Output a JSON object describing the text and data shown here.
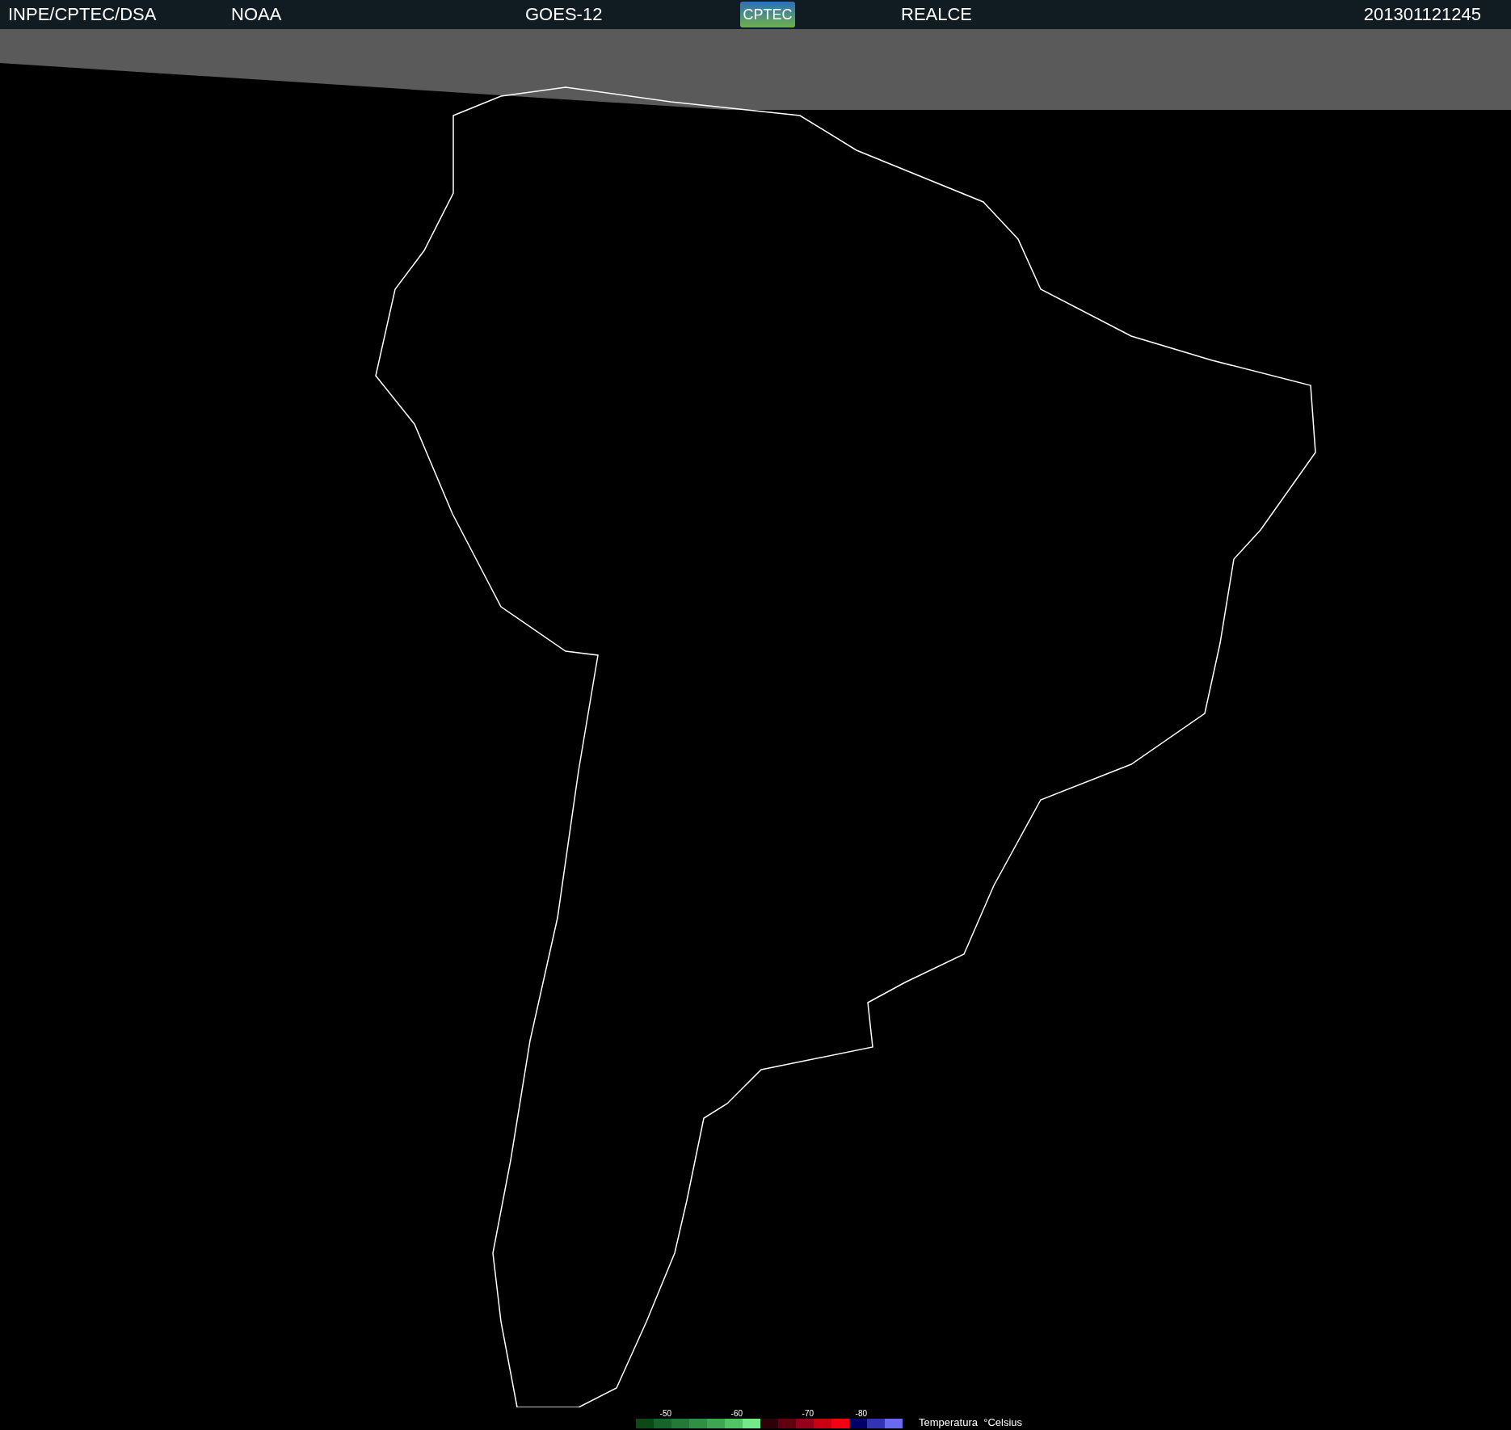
{
  "header": {
    "source": "INPE/CPTEC/DSA",
    "agency": "NOAA",
    "satellite": "GOES-12",
    "logo": "CPTEC",
    "product": "REALCE",
    "timestamp": "201301121245"
  },
  "legend": {
    "title": "Temperatura  °Celsius",
    "swatches": [
      {
        "color": "#0b4a16"
      },
      {
        "color": "#17652a",
        "label": "-50"
      },
      {
        "color": "#237a36"
      },
      {
        "color": "#2f9043"
      },
      {
        "color": "#3ea653"
      },
      {
        "color": "#52c466",
        "label": "-60"
      },
      {
        "color": "#74e88a"
      },
      {
        "color": "#2e0008"
      },
      {
        "color": "#600010"
      },
      {
        "color": "#96001a",
        "label": "-70"
      },
      {
        "color": "#cc0014"
      },
      {
        "color": "#f40012"
      },
      {
        "color": "#000066",
        "label": "-80"
      },
      {
        "color": "#3333b3"
      },
      {
        "color": "#6a6af0"
      }
    ]
  }
}
